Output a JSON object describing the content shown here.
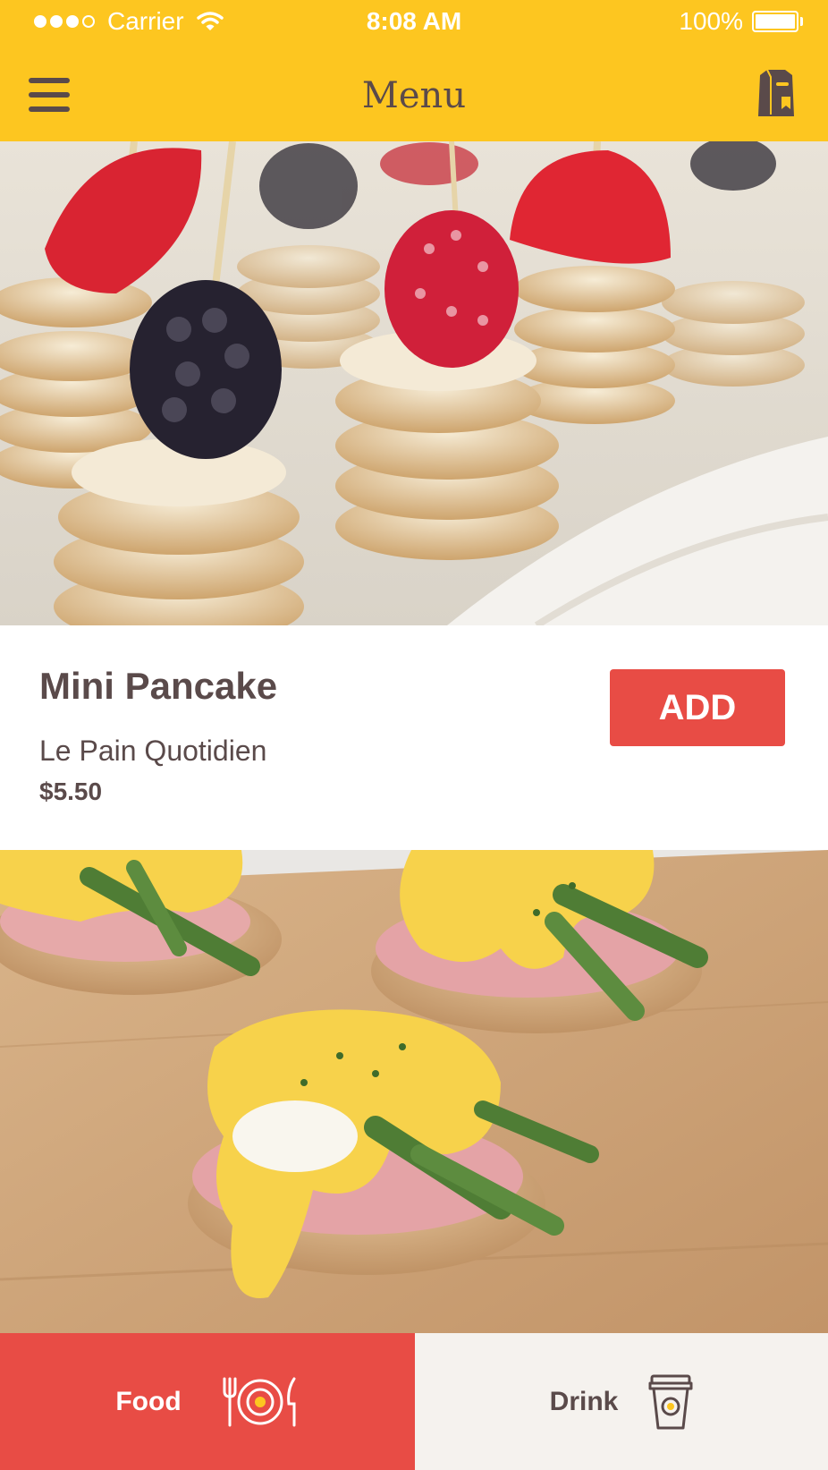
{
  "status_bar": {
    "carrier": "Carrier",
    "time": "8:08 AM",
    "battery": "100%",
    "signal_bars": 3,
    "signal_total": 4
  },
  "nav": {
    "title": "Menu",
    "left_icon": "hamburger-menu-icon",
    "right_icon": "shopping-bag-icon"
  },
  "items": [
    {
      "name": "Mini Pancake",
      "vendor": "Le Pain Quotidien",
      "price": "$5.50",
      "button": "ADD"
    }
  ],
  "tabs": [
    {
      "label": "Food",
      "icon": "fork-plate-knife-icon",
      "active": true
    },
    {
      "label": "Drink",
      "icon": "coffee-cup-icon",
      "active": false
    }
  ],
  "colors": {
    "header": "#FDC620",
    "accent": "#E84C45",
    "text": "#5A4A4A",
    "tab_inactive": "#F5F2EE"
  }
}
